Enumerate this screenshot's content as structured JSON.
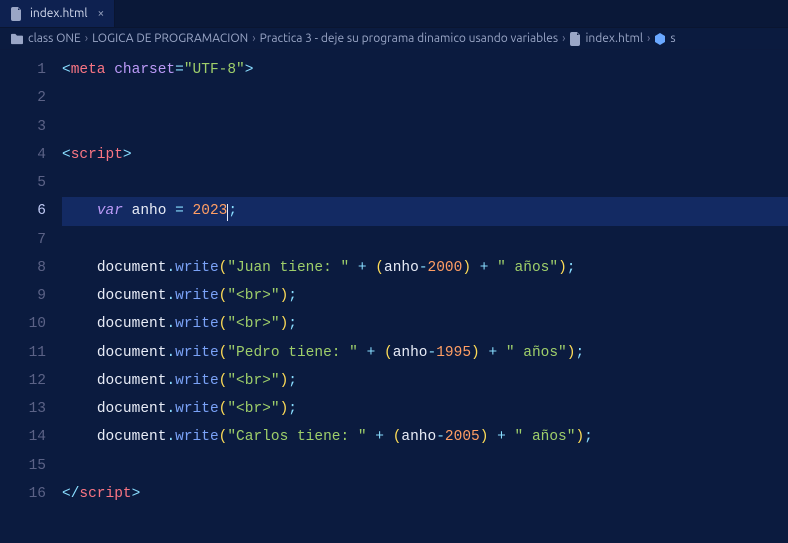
{
  "tab": {
    "filename": "index.html",
    "close_glyph": "×"
  },
  "breadcrumbs": {
    "items": [
      {
        "icon": "folder",
        "label": "class ONE"
      },
      {
        "icon": null,
        "label": "LOGICA DE PROGRAMACION"
      },
      {
        "icon": null,
        "label": "Practica 3 - deje su programa dinamico usando variables"
      },
      {
        "icon": "file",
        "label": "index.html"
      },
      {
        "icon": "cube",
        "label": "s"
      }
    ],
    "sep": "›"
  },
  "editor": {
    "current_line": 6,
    "cursor_after_col": 22,
    "line_numbers": [
      "1",
      "2",
      "3",
      "4",
      "5",
      "6",
      "7",
      "8",
      "9",
      "10",
      "11",
      "12",
      "13",
      "14",
      "15",
      "16"
    ],
    "code": {
      "var_keyword": "var",
      "var_name": "anho",
      "var_value": "2023",
      "meta_tag": "meta",
      "meta_attr": "charset",
      "meta_val": "\"UTF-8\"",
      "script_tag": "script",
      "doc_obj": "document",
      "write_fn": "write",
      "str_juan": "\"Juan tiene: \"",
      "str_pedro": "\"Pedro tiene: \"",
      "str_carlos": "\"Carlos tiene: \"",
      "str_anios": "\" años\"",
      "str_br": "\"<br>\"",
      "year_juan": "2000",
      "year_pedro": "1995",
      "year_carlos": "2005"
    }
  }
}
